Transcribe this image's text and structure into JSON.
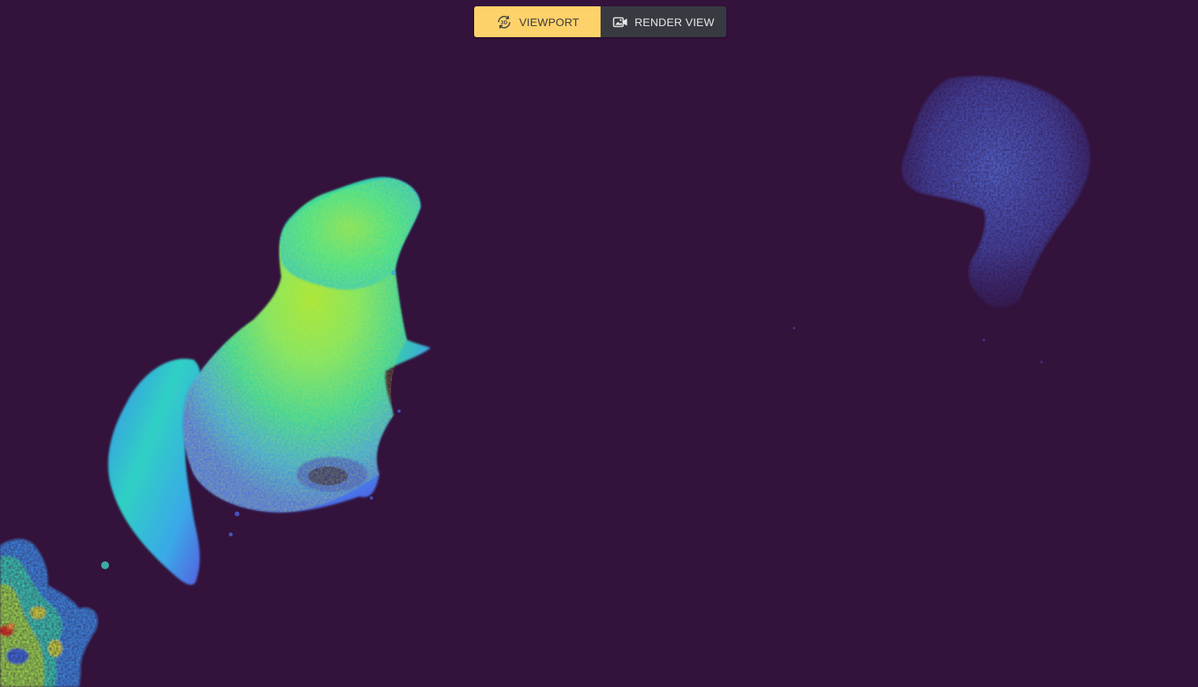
{
  "toolbar": {
    "viewport_label": "VIEWPORT",
    "render_view_label": "RENDER VIEW",
    "active_mode": "viewport",
    "viewport_icon": "rotate-3d-icon",
    "render_view_icon": "camera-image-icon"
  },
  "colors": {
    "background": "#33123b",
    "active_button": "#fdd26b",
    "inactive_button": "#373a40"
  },
  "scene": {
    "colormap": "turbo-depth"
  }
}
